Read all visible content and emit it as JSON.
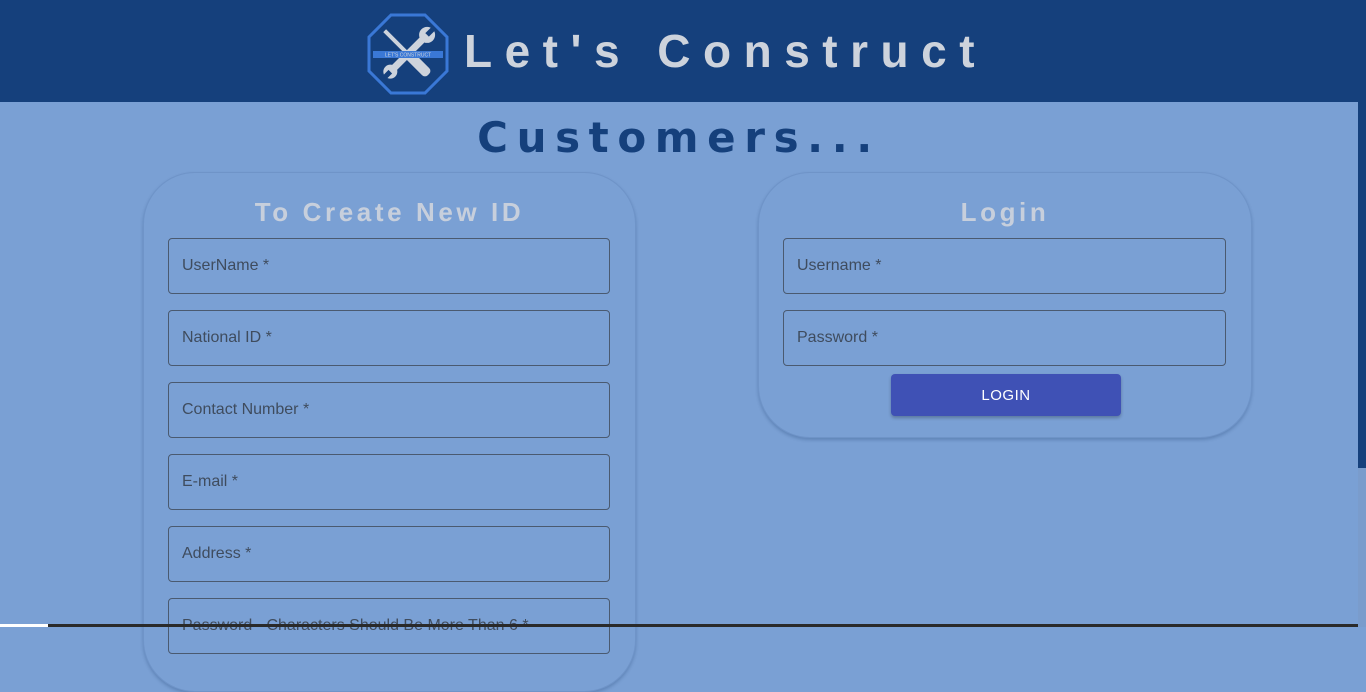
{
  "header": {
    "brand": "Let's Construct",
    "logo_icon": "tools-wrench-screwdriver-icon",
    "logo_text": "LET'S CONSTRUCT",
    "background": "#15407c"
  },
  "page": {
    "title": "Customers...",
    "background": "#7aa0d4"
  },
  "create_form": {
    "title": "To Create New ID",
    "fields": [
      "UserName *",
      "National ID *",
      "Contact Number *",
      "E-mail *",
      "Address *",
      "Password - Characters Should Be More Than 6 *"
    ]
  },
  "login_form": {
    "title": "Login",
    "fields": [
      "Username *",
      "Password *"
    ],
    "button": "LOGIN",
    "button_color": "#3f51b5"
  }
}
